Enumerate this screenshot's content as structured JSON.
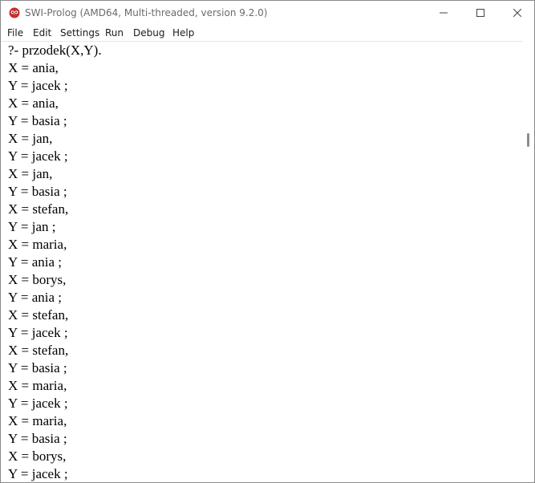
{
  "window": {
    "title": "SWI-Prolog (AMD64, Multi-threaded, version 9.2.0)",
    "accent_icon_color": "#cc2b2b"
  },
  "menu": {
    "items": [
      "File",
      "Edit",
      "Settings",
      "Run",
      "Debug",
      "Help"
    ]
  },
  "console": {
    "lines": [
      "?- przodek(X,Y).",
      "X = ania,",
      "Y = jacek ;",
      "X = ania,",
      "Y = basia ;",
      "X = jan,",
      "Y = jacek ;",
      "X = jan,",
      "Y = basia ;",
      "X = stefan,",
      "Y = jan ;",
      "X = maria,",
      "Y = ania ;",
      "X = borys,",
      "Y = ania ;",
      "X = stefan,",
      "Y = jacek ;",
      "X = stefan,",
      "Y = basia ;",
      "X = maria,",
      "Y = jacek ;",
      "X = maria,",
      "Y = basia ;",
      "X = borys,",
      "Y = jacek ;"
    ]
  },
  "icons": {
    "app": "swi-prolog-owl-icon",
    "minimize": "minimize-icon",
    "maximize": "maximize-icon",
    "close": "close-icon"
  }
}
